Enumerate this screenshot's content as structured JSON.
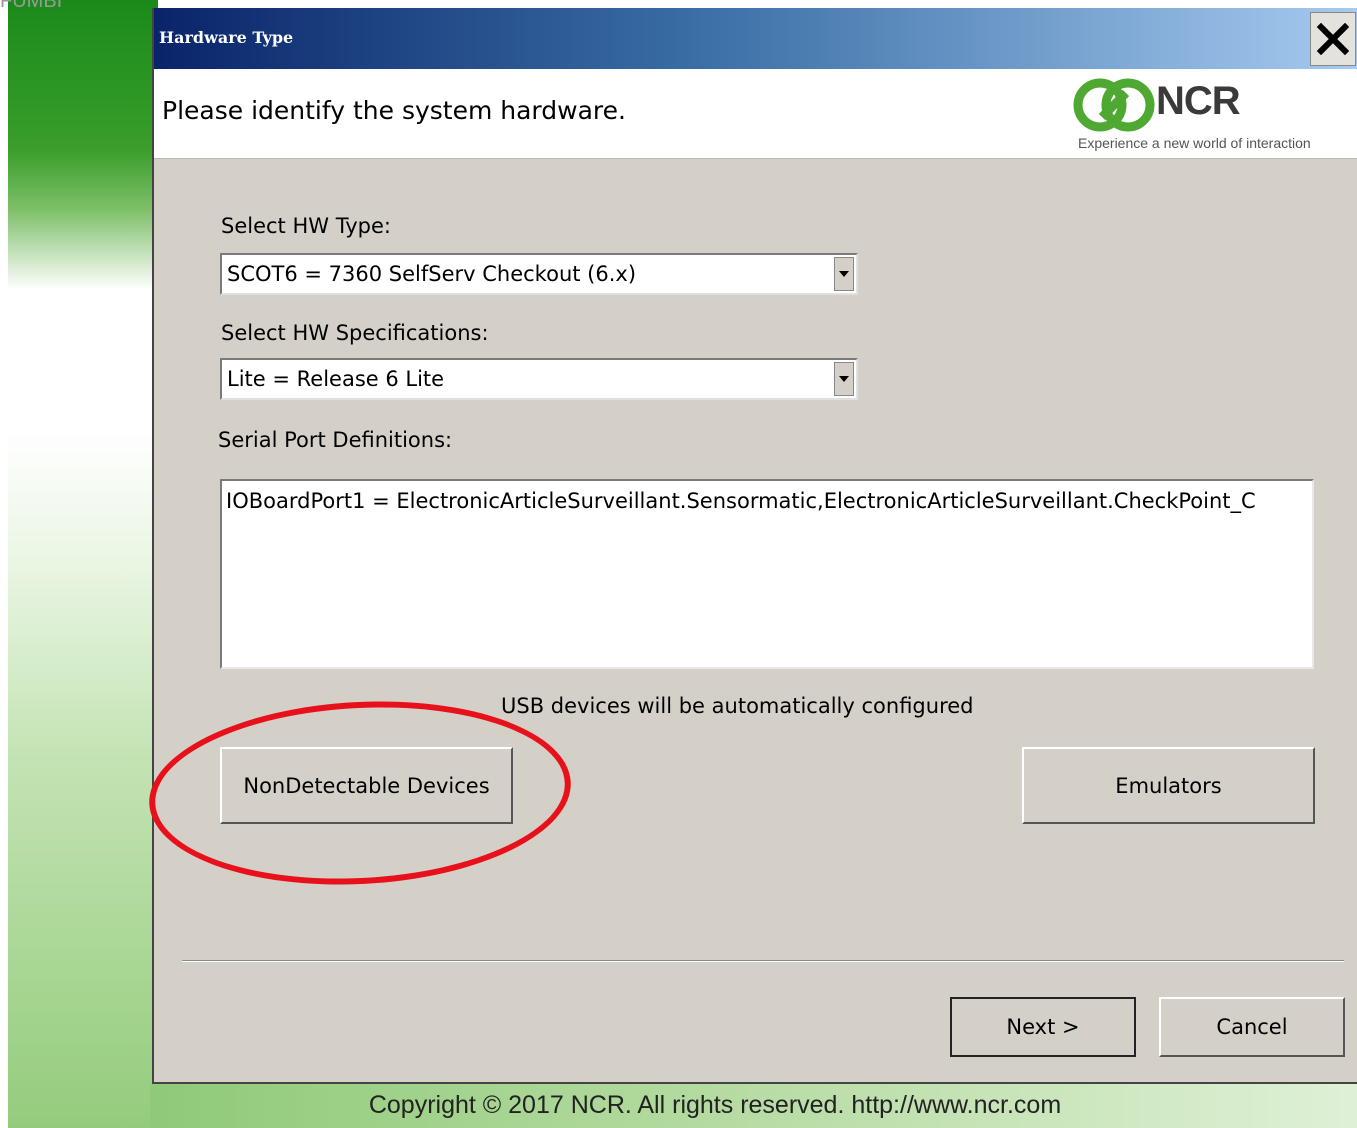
{
  "corner_text": "FUMBI",
  "window": {
    "title": "Hardware Type",
    "close_icon": "close-x-icon"
  },
  "header": {
    "prompt": "Please identify the system hardware.",
    "logo": {
      "name": "NCR",
      "tagline": "Experience a new world of interaction",
      "icon": "ncr-logo-icon",
      "color": "#4fa832"
    }
  },
  "form": {
    "hw_type": {
      "label": "Select HW Type:",
      "value": "SCOT6 = 7360 SelfServ Checkout (6.x)"
    },
    "hw_spec": {
      "label": "Select HW Specifications:",
      "value": "Lite = Release 6 Lite"
    },
    "serial_ports": {
      "label": "Serial Port Definitions:",
      "value": "IOBoardPort1 = ElectronicArticleSurveillant.Sensormatic,ElectronicArticleSurveillant.CheckPoint_C"
    },
    "usb_note": "USB devices will be automatically configured"
  },
  "buttons": {
    "nondetectable": "NonDetectable Devices",
    "emulators": "Emulators",
    "next": "Next >",
    "cancel": "Cancel"
  },
  "annotation_color": "#e8101a",
  "footer": {
    "copyright": "Copyright © 2017 NCR. All rights reserved. http://www.ncr.com"
  }
}
